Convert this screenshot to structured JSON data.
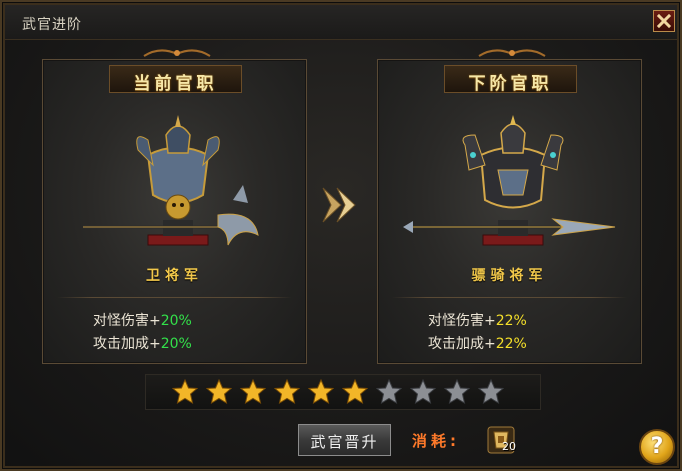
{
  "window": {
    "title": "武官进阶"
  },
  "close_icon": "close-icon",
  "current": {
    "header": "当前官职",
    "rank": "卫将军",
    "stats": [
      {
        "label": "对怪伤害+",
        "value": "20%"
      },
      {
        "label": "攻击加成+",
        "value": "20%"
      }
    ]
  },
  "next": {
    "header": "下阶官职",
    "rank": "骠骑将军",
    "stats": [
      {
        "label": "对怪伤害+",
        "value": "22%"
      },
      {
        "label": "攻击加成+",
        "value": "22%"
      }
    ]
  },
  "stars": {
    "filled": 6,
    "total": 10
  },
  "actions": {
    "promote_label": "武官晋升",
    "cost_label": "消耗:",
    "cost_count": "20",
    "help_label": "?"
  },
  "colors": {
    "accent_gold": "#f2c84a",
    "stat_green": "#33e04a",
    "stat_yellow": "#f4df2a",
    "cost_orange": "#ff7a2a"
  }
}
